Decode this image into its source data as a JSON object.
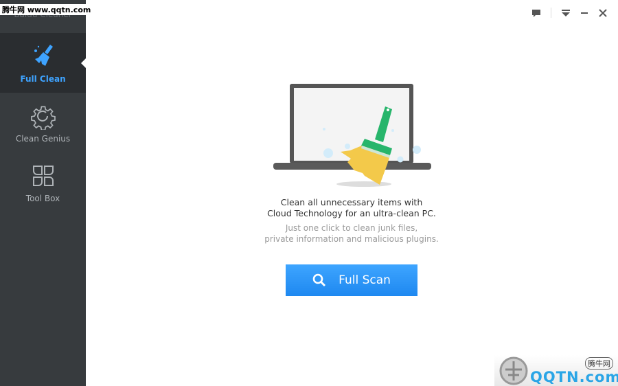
{
  "app": {
    "title": "Baidu Cleaner"
  },
  "watermark": {
    "top": "腾牛网 www.qqtn.com",
    "bottom_logo": "QQTN.com",
    "bottom_badge": "腾牛网"
  },
  "sidebar": {
    "items": [
      {
        "label": "Full Clean",
        "icon": "broom-icon",
        "active": true
      },
      {
        "label": "Clean Genius",
        "icon": "gear-icon",
        "active": false
      },
      {
        "label": "Tool Box",
        "icon": "grid-icon",
        "active": false
      }
    ]
  },
  "window_controls": [
    "feedback-icon",
    "menu-icon",
    "minimize-icon",
    "close-icon"
  ],
  "main": {
    "headline_1": "Clean all unnecessary items with",
    "headline_2": "Cloud Technology for an ultra-clean PC.",
    "sub_1": "Just one click to clean junk files,",
    "sub_2": "private information and malicious plugins.",
    "scan_button": "Full Scan"
  },
  "colors": {
    "accent": "#3ea3ff",
    "sidebar": "#373b3e",
    "sidebar_active": "#2a2d30",
    "broom_green": "#27b56b",
    "broom_yellow": "#f3c94a"
  }
}
